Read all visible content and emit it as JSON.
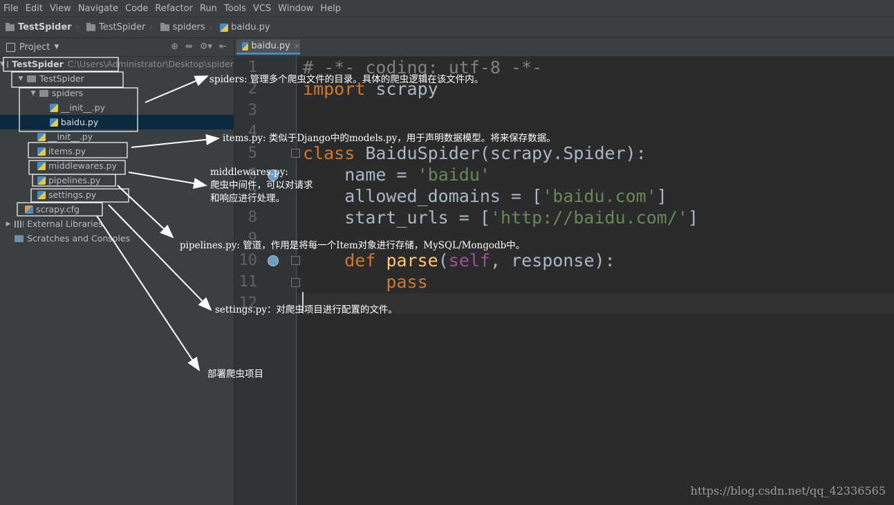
{
  "menu": [
    "File",
    "Edit",
    "View",
    "Navigate",
    "Code",
    "Refactor",
    "Run",
    "Tools",
    "VCS",
    "Window",
    "Help"
  ],
  "breadcrumb": [
    "TestSpider",
    "TestSpider",
    "spiders",
    "baidu.py"
  ],
  "project_panel": {
    "title": "Project",
    "dropdown": "▼",
    "tool_icons": [
      "⊕",
      "⇹",
      "⚙▾",
      "⇤"
    ]
  },
  "tree": {
    "root": {
      "name": "TestSpider",
      "path": "C:\\Users\\Administrator\\Desktop\\spider"
    },
    "items": [
      {
        "label": "TestSpider",
        "indent": 2,
        "type": "folder",
        "arrow": "▼"
      },
      {
        "label": "spiders",
        "indent": 3,
        "type": "folder",
        "arrow": "▼"
      },
      {
        "label": "__init__.py",
        "indent": 4,
        "type": "py"
      },
      {
        "label": "baidu.py",
        "indent": 4,
        "type": "py",
        "selected": true
      },
      {
        "label": "__init__.py",
        "indent": 3,
        "type": "py"
      },
      {
        "label": "items.py",
        "indent": 3,
        "type": "py"
      },
      {
        "label": "middlewares.py",
        "indent": 3,
        "type": "py"
      },
      {
        "label": "pipelines.py",
        "indent": 3,
        "type": "py"
      },
      {
        "label": "settings.py",
        "indent": 3,
        "type": "py"
      },
      {
        "label": "scrapy.cfg",
        "indent": 2,
        "type": "cfg"
      },
      {
        "label": "External Libraries",
        "indent": 1,
        "type": "lib",
        "arrow": "▶"
      },
      {
        "label": "Scratches and Consoles",
        "indent": 1,
        "type": "scratch"
      }
    ]
  },
  "editor_tab": {
    "label": "baidu.py",
    "close": "×"
  },
  "line_numbers": [
    "1",
    "2",
    "3",
    "4",
    "5",
    "6",
    "7",
    "8",
    "9",
    "10",
    "11",
    "12"
  ],
  "code_lines": [
    "# -*- coding: utf-8 -*-",
    "import scrapy",
    "",
    "",
    "class BaiduSpider(scrapy.Spider):",
    "    name = 'baidu'",
    "    allowed_domains = ['baidu.com']",
    "    start_urls = ['http://baidu.com/']",
    "",
    "    def parse(self, response):",
    "        pass",
    ""
  ],
  "annotations": {
    "spiders": "spiders: 管理多个爬虫文件的目录。具体的爬虫逻辑在该文件内。",
    "items": "items.py: 类似于Django中的models.py，用于声明数据模型。将来保存数据。",
    "middlewares_title": "middlewares.py:",
    "middlewares_line1": "爬虫中间件，可以对请求",
    "middlewares_line2": "和响应进行处理。",
    "pipelines": "pipelines.py: 管道，作用是将每一个Item对象进行存储，MySQL/Mongodb中。",
    "settings": "settings.py：对爬虫项目进行配置的文件。",
    "scrapy_cfg": "部署爬虫项目"
  },
  "watermark": "https://blog.csdn.net/qq_42336565"
}
